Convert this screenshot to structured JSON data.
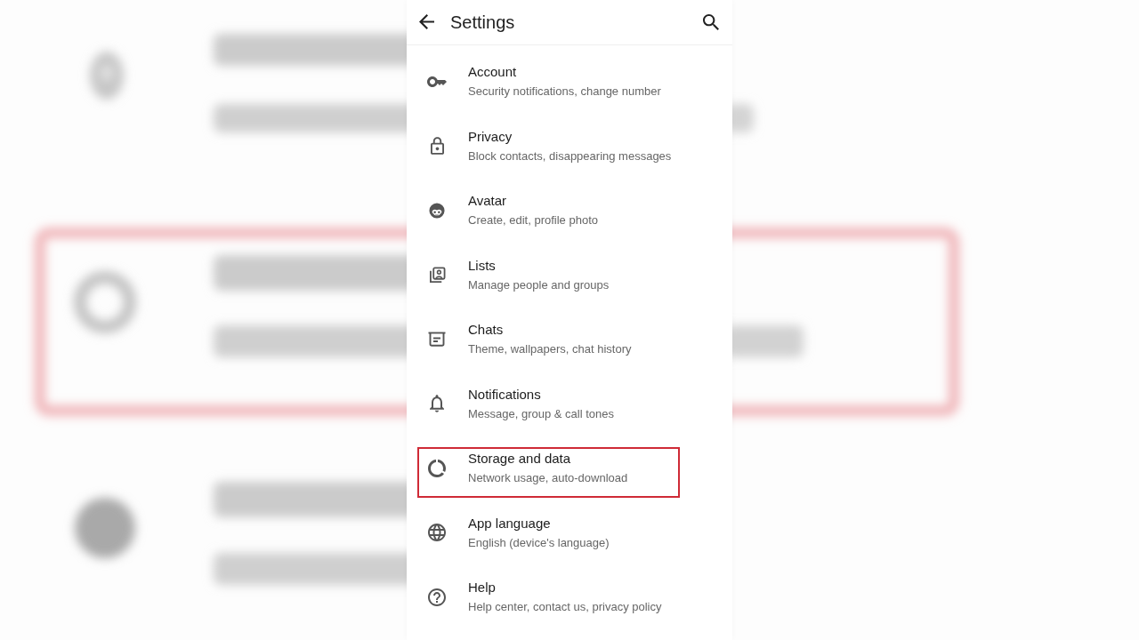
{
  "app_bar": {
    "title": "Settings"
  },
  "items": [
    {
      "title": "Account",
      "subtitle": "Security notifications, change number",
      "highlighted": false
    },
    {
      "title": "Privacy",
      "subtitle": "Block contacts, disappearing messages",
      "highlighted": false
    },
    {
      "title": "Avatar",
      "subtitle": "Create, edit, profile photo",
      "highlighted": false
    },
    {
      "title": "Lists",
      "subtitle": "Manage people and groups",
      "highlighted": false
    },
    {
      "title": "Chats",
      "subtitle": "Theme, wallpapers, chat history",
      "highlighted": false
    },
    {
      "title": "Notifications",
      "subtitle": "Message, group & call tones",
      "highlighted": false
    },
    {
      "title": "Storage and data",
      "subtitle": "Network usage, auto-download",
      "highlighted": true
    },
    {
      "title": "App language",
      "subtitle": "English (device's language)",
      "highlighted": false
    },
    {
      "title": "Help",
      "subtitle": "Help center, contact us, privacy policy",
      "highlighted": false
    }
  ]
}
